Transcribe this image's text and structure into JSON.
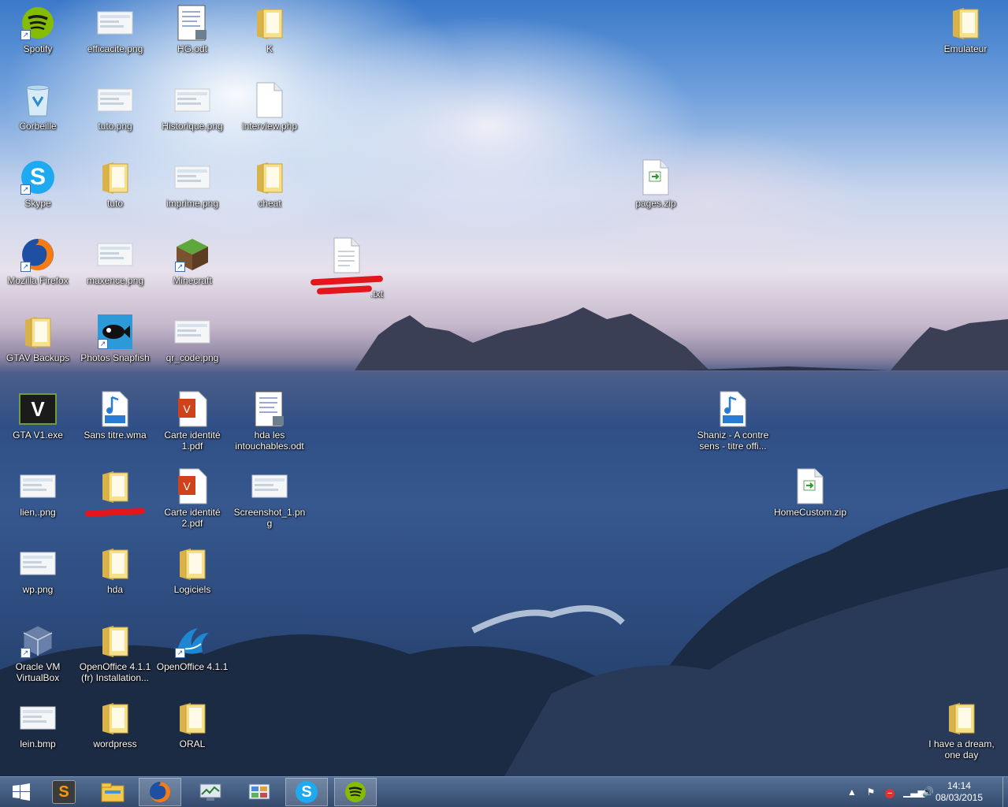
{
  "desktop": {
    "icons": [
      {
        "id": "spotify",
        "label": "Spotify",
        "icon": "spotify-icon"
      },
      {
        "id": "efficacite",
        "label": "efficacite.png",
        "icon": "image-icon"
      },
      {
        "id": "hg",
        "label": "HG.odt",
        "icon": "document-icon"
      },
      {
        "id": "k",
        "label": "K",
        "icon": "folder-icon"
      },
      {
        "id": "emulateur",
        "label": "Emulateur",
        "icon": "folder-icon"
      },
      {
        "id": "corbeille",
        "label": "Corbeille",
        "icon": "recycle-bin-icon"
      },
      {
        "id": "tuto-png",
        "label": "tuto.png",
        "icon": "image-icon"
      },
      {
        "id": "historique",
        "label": "Historique.png",
        "icon": "image-icon"
      },
      {
        "id": "interview",
        "label": "interview.php",
        "icon": "file-icon"
      },
      {
        "id": "skype",
        "label": "Skype",
        "icon": "skype-icon"
      },
      {
        "id": "tuto",
        "label": "tuto",
        "icon": "folder-icon"
      },
      {
        "id": "imprime",
        "label": "imprime.png",
        "icon": "image-icon"
      },
      {
        "id": "cheat",
        "label": "cheat",
        "icon": "folder-icon"
      },
      {
        "id": "pages",
        "label": "pages.zip",
        "icon": "zip-icon"
      },
      {
        "id": "firefox",
        "label": "Mozilla Firefox",
        "icon": "firefox-icon"
      },
      {
        "id": "maxence",
        "label": "maxence.png",
        "icon": "image-icon"
      },
      {
        "id": "minecraft",
        "label": "Minecraft",
        "icon": "minecraft-icon"
      },
      {
        "id": "txt-redacted",
        "label": ".txt",
        "icon": "text-file-icon"
      },
      {
        "id": "gtav-backups",
        "label": "GTAV Backups",
        "icon": "folder-icon"
      },
      {
        "id": "snapfish",
        "label": "Photos Snapfish",
        "icon": "snapfish-icon"
      },
      {
        "id": "qrcode",
        "label": "qr_code.png",
        "icon": "image-icon"
      },
      {
        "id": "gta",
        "label": "GTA V1.exe",
        "icon": "gta-icon"
      },
      {
        "id": "sans-titre",
        "label": "Sans titre.wma",
        "icon": "audio-icon"
      },
      {
        "id": "carte1",
        "label": "Carte identité 1.pdf",
        "icon": "pdf-icon"
      },
      {
        "id": "hda-odt",
        "label": "hda les intouchables.odt",
        "icon": "document-icon"
      },
      {
        "id": "shaniz",
        "label": "Shaniz - A contre sens - titre offi...",
        "icon": "mp3-icon"
      },
      {
        "id": "lien",
        "label": "lien,.png",
        "icon": "image-icon"
      },
      {
        "id": "folder-redacted",
        "label": "",
        "icon": "folder-icon"
      },
      {
        "id": "carte2",
        "label": "Carte identité 2.pdf",
        "icon": "pdf-icon"
      },
      {
        "id": "screenshot",
        "label": "Screenshot_1.png",
        "icon": "image-icon"
      },
      {
        "id": "homecustom",
        "label": "HomeCustom.zip",
        "icon": "zip-icon"
      },
      {
        "id": "wp",
        "label": "wp.png",
        "icon": "image-icon"
      },
      {
        "id": "hda",
        "label": "hda",
        "icon": "folder-icon"
      },
      {
        "id": "logiciels",
        "label": "Logiciels",
        "icon": "folder-icon"
      },
      {
        "id": "virtualbox",
        "label": "Oracle VM VirtualBox",
        "icon": "virtualbox-icon"
      },
      {
        "id": "oo-install",
        "label": "OpenOffice 4.1.1 (fr) Installation...",
        "icon": "folder-icon"
      },
      {
        "id": "openoffice",
        "label": "OpenOffice 4.1.1",
        "icon": "openoffice-icon"
      },
      {
        "id": "lein",
        "label": "lein.bmp",
        "icon": "image-icon"
      },
      {
        "id": "wordpress",
        "label": "wordpress",
        "icon": "folder-icon"
      },
      {
        "id": "oral",
        "label": "ORAL",
        "icon": "folder-icon"
      },
      {
        "id": "dream",
        "label": "I have a dream, one day",
        "icon": "folder-icon"
      }
    ]
  },
  "taskbar": {
    "apps": [
      {
        "id": "start",
        "icon": "windows-logo-icon"
      },
      {
        "id": "sublime",
        "icon": "sublime-text-icon"
      },
      {
        "id": "explorer",
        "icon": "file-explorer-icon"
      },
      {
        "id": "firefox",
        "icon": "firefox-icon"
      },
      {
        "id": "resource",
        "icon": "network-monitor-icon"
      },
      {
        "id": "control",
        "icon": "control-panel-icon"
      },
      {
        "id": "skype",
        "icon": "skype-icon"
      },
      {
        "id": "spotify",
        "icon": "spotify-icon"
      }
    ],
    "clock": {
      "time": "14:14",
      "date": "08/03/2015"
    }
  }
}
